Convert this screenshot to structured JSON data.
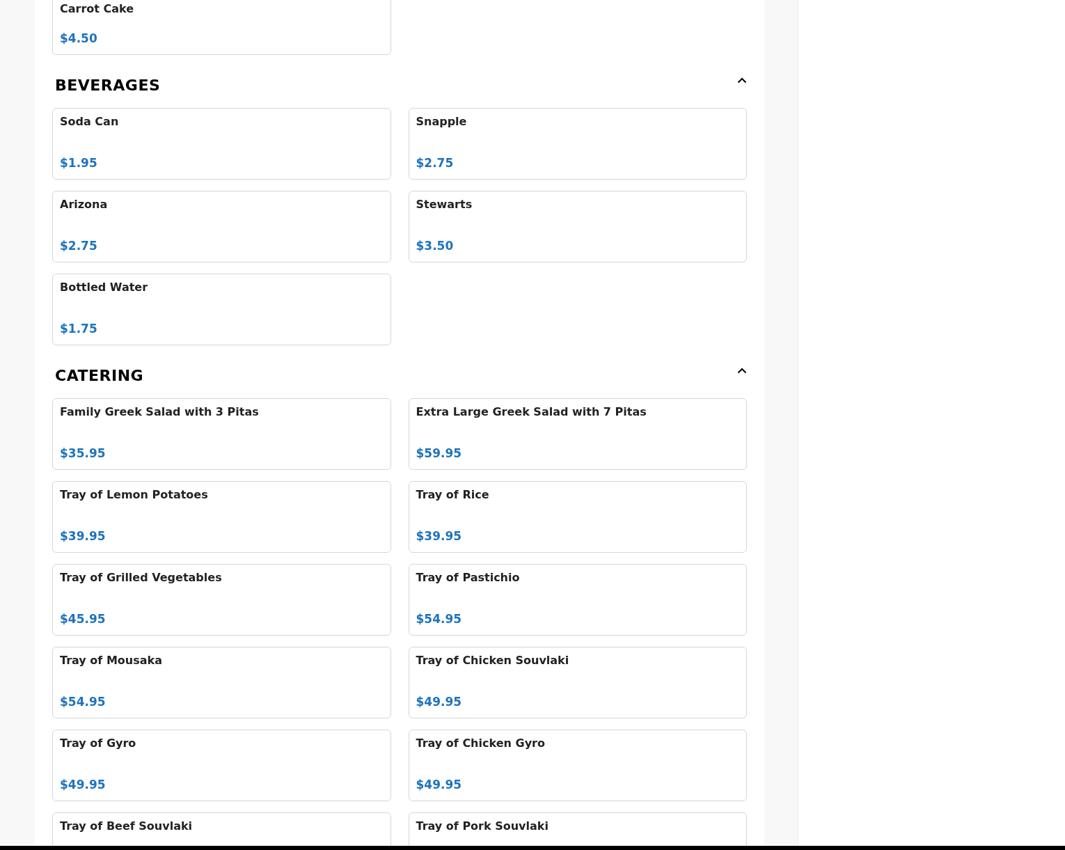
{
  "partial_section": {
    "items": [
      {
        "name": "Carrot Cake",
        "price": "$4.50"
      }
    ]
  },
  "sections": [
    {
      "title": "BEVERAGES",
      "expanded": true,
      "items": [
        {
          "name": "Soda Can",
          "price": "$1.95"
        },
        {
          "name": "Snapple",
          "price": "$2.75"
        },
        {
          "name": "Arizona",
          "price": "$2.75"
        },
        {
          "name": "Stewarts",
          "price": "$3.50"
        },
        {
          "name": "Bottled Water",
          "price": "$1.75"
        }
      ]
    },
    {
      "title": "CATERING",
      "expanded": true,
      "items": [
        {
          "name": "Family Greek Salad with 3 Pitas",
          "price": "$35.95"
        },
        {
          "name": "Extra Large Greek Salad with 7 Pitas",
          "price": "$59.95"
        },
        {
          "name": "Tray of Lemon Potatoes",
          "price": "$39.95"
        },
        {
          "name": "Tray of Rice",
          "price": "$39.95"
        },
        {
          "name": "Tray of Grilled Vegetables",
          "price": "$45.95"
        },
        {
          "name": "Tray of Pastichio",
          "price": "$54.95"
        },
        {
          "name": "Tray of Mousaka",
          "price": "$54.95"
        },
        {
          "name": "Tray of Chicken Souvlaki",
          "price": "$49.95"
        },
        {
          "name": "Tray of Gyro",
          "price": "$49.95"
        },
        {
          "name": "Tray of Chicken Gyro",
          "price": "$49.95"
        },
        {
          "name": "Tray of Beef Souvlaki"
        },
        {
          "name": "Tray of Pork Souvlaki"
        }
      ]
    }
  ]
}
